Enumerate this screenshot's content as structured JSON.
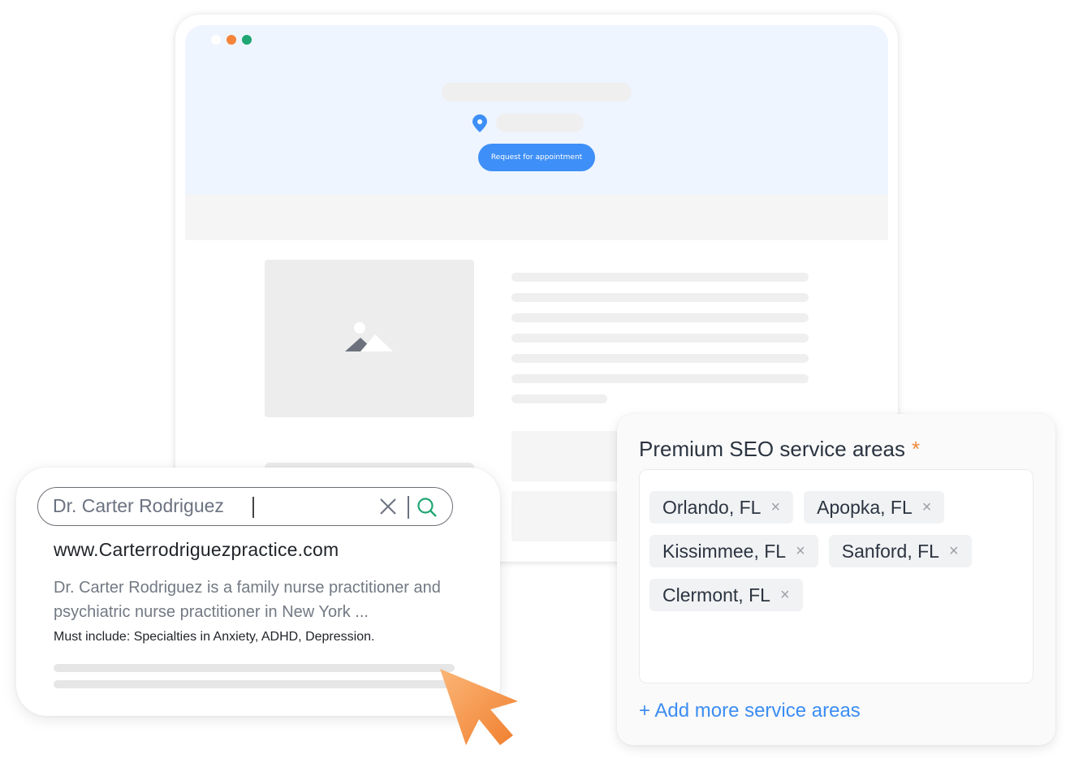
{
  "browser": {
    "window_controls": [
      {
        "name": "close",
        "color": "#ffffff"
      },
      {
        "name": "minimize",
        "color": "#f5843a"
      },
      {
        "name": "maximize",
        "color": "#1fa672"
      }
    ],
    "hero": {
      "button_label": "Request for appointment",
      "accent_color": "#3e8ff7"
    }
  },
  "search": {
    "query": "Dr. Carter Rodriguez",
    "result": {
      "url": "www.Carterrodriguezpractice.com",
      "description": "Dr. Carter Rodriguez is a family nurse practitioner and psychiatric nurse practitioner in New York ...",
      "note": "Must include: Specialties in Anxiety, ADHD, Depression."
    }
  },
  "service_areas": {
    "title": "Premium SEO service areas",
    "required_marker": "*",
    "tags": [
      {
        "label": "Orlando, FL"
      },
      {
        "label": "Apopka, FL"
      },
      {
        "label": "Kissimmee, FL"
      },
      {
        "label": "Sanford, FL"
      },
      {
        "label": "Clermont, FL"
      }
    ],
    "remove_glyph": "×",
    "add_link": "+ Add more service areas"
  }
}
